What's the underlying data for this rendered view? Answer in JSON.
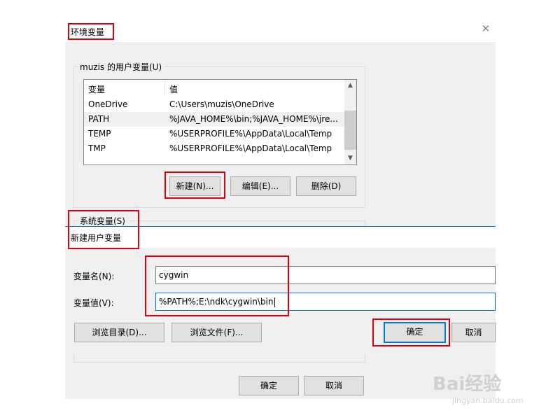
{
  "env_window": {
    "title": "环境变量",
    "user_group_title": "muzis 的用户变量(U)",
    "columns": [
      "变量",
      "值"
    ],
    "rows": [
      {
        "name": "OneDrive",
        "value": "C:\\Users\\muzis\\OneDrive"
      },
      {
        "name": "PATH",
        "value": "%JAVA_HOME%\\bin;%JAVA_HOME%\\jre..."
      },
      {
        "name": "TEMP",
        "value": "%USERPROFILE%\\AppData\\Local\\Temp"
      },
      {
        "name": "TMP",
        "value": "%USERPROFILE%\\AppData\\Local\\Temp"
      }
    ],
    "selected_row": 1,
    "buttons": {
      "new": "新建(N)...",
      "edit": "编辑(E)...",
      "delete": "删除(D)"
    },
    "system_group_title": "系统变量(S)",
    "ok": "确定",
    "cancel": "取消"
  },
  "new_var_dialog": {
    "title": "新建用户变量",
    "name_label": "变量名(N):",
    "value_label": "变量值(V):",
    "name_value": "cygwin",
    "value_value": "%PATH%;E:\\ndk\\cygwin\\bin",
    "browse_dir": "浏览目录(D)...",
    "browse_file": "浏览文件(F)...",
    "ok": "确定",
    "cancel": "取消"
  },
  "watermark": {
    "brand": "Bai经验",
    "url": "jingyan.baidu.com"
  },
  "colors": {
    "highlight_red": "#e0000c",
    "focus_blue": "#0078d7"
  }
}
